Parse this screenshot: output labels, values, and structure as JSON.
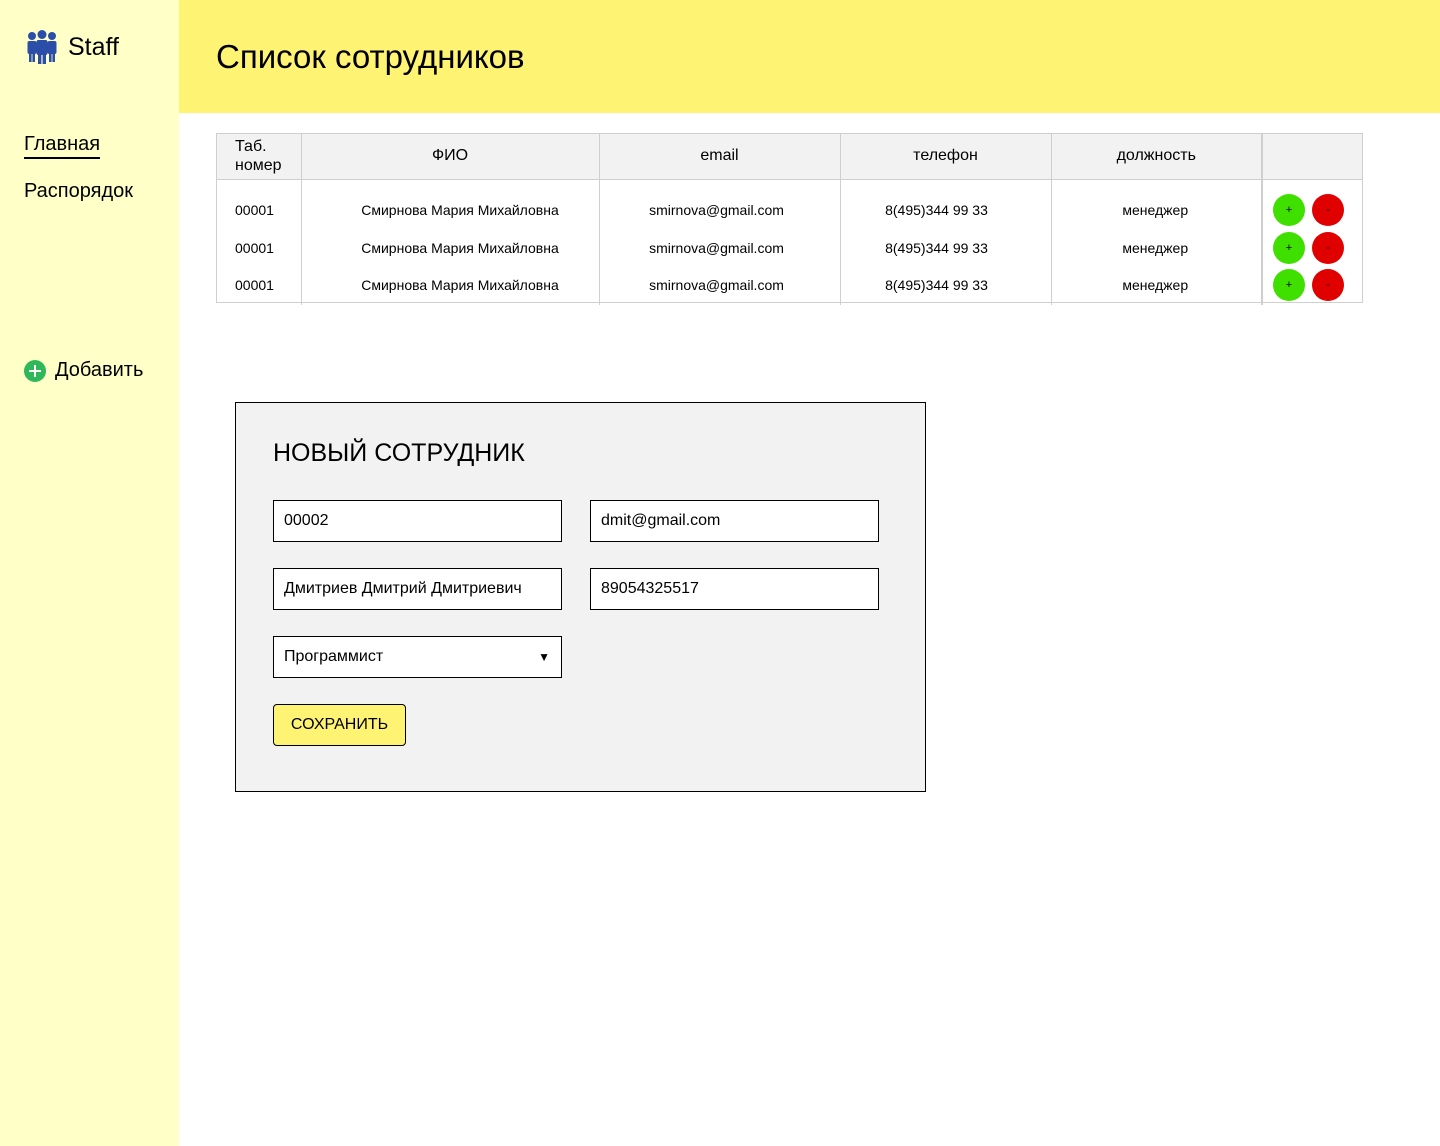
{
  "app": {
    "name": "Staff",
    "logo_icon": "people-group-icon",
    "logo_color": "#2b4fa8"
  },
  "sidebar": {
    "nav": [
      {
        "label": "Главная",
        "active": true
      },
      {
        "label": "Распорядок",
        "active": false
      }
    ],
    "add": {
      "label": "Добавить",
      "icon": "plus-circle-icon",
      "color": "#2fb85a"
    }
  },
  "header": {
    "title": "Список сотрудников"
  },
  "table": {
    "columns": [
      "Таб. номер",
      "ФИО",
      "email",
      "телефон",
      "должность",
      ""
    ],
    "rows": [
      {
        "num": "00001",
        "fio": "Смирнова Мария Михайловна",
        "email": "smirnova@gmail.com",
        "phone": "8(495)344 99 33",
        "position": "менеджер"
      },
      {
        "num": "00001",
        "fio": "Смирнова Мария Михайловна",
        "email": "smirnova@gmail.com",
        "phone": "8(495)344 99 33",
        "position": "менеджер"
      },
      {
        "num": "00001",
        "fio": "Смирнова Мария Михайловна",
        "email": "smirnova@gmail.com",
        "phone": "8(495)344 99 33",
        "position": "менеджер"
      }
    ],
    "action_plus": "+",
    "action_minus": "-"
  },
  "form": {
    "title": "НОВЫЙ СОТРУДНИК",
    "num_value": "00002",
    "email_value": "dmit@gmail.com",
    "fio_value": "Дмитриев Дмитрий Дмитриевич",
    "phone_value": "89054325517",
    "position_selected": "Программист",
    "select_arrow": "▼",
    "save_label": "СОХРАНИТЬ"
  },
  "colors": {
    "sidebar_bg": "#ffffc8",
    "header_bg": "#fff374",
    "plus_btn": "#3fe000",
    "minus_btn": "#e00000",
    "form_bg": "#f2f2f2",
    "save_btn": "#fff374"
  }
}
